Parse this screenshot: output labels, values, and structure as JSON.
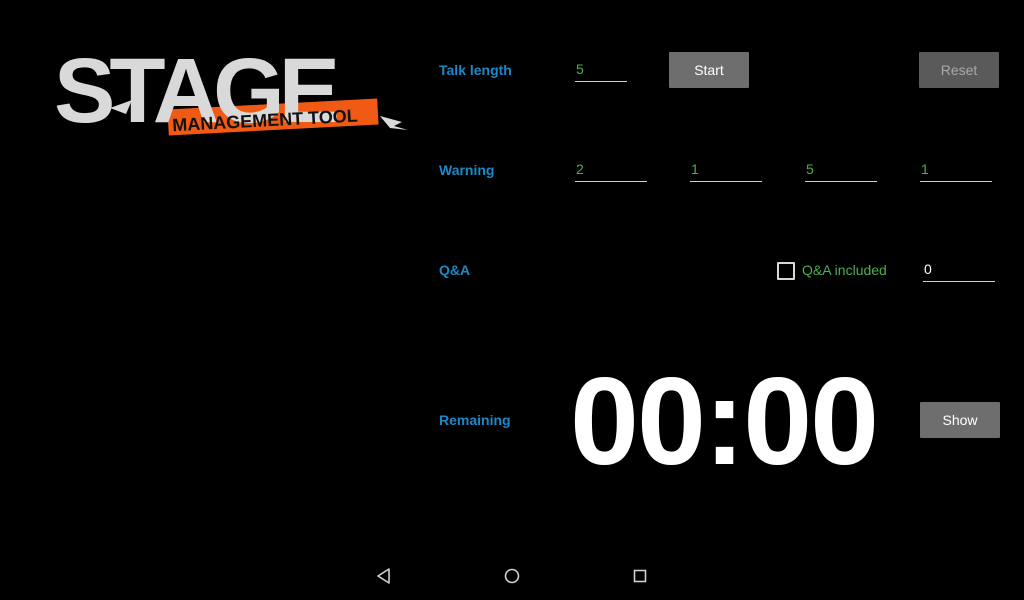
{
  "logo": {
    "main_text": "STAGE",
    "sub_text": "MANAGEMENT TOOL",
    "banner_color": "#f05a14",
    "text_color": "#d9d9d9"
  },
  "talk_length": {
    "label": "Talk length",
    "value": "5",
    "start_label": "Start",
    "reset_label": "Reset"
  },
  "warning": {
    "label": "Warning",
    "values": [
      "2",
      "1",
      "5",
      "1"
    ]
  },
  "qa": {
    "label": "Q&A",
    "checkbox_label": "Q&A included",
    "checked": false,
    "value": "0"
  },
  "remaining": {
    "label": "Remaining",
    "timer": "00:00",
    "show_label": "Show"
  },
  "navbar": {
    "back_icon": "back-triangle",
    "home_icon": "home-circle",
    "recents_icon": "recents-square"
  },
  "colors": {
    "label_blue": "#1e88c7",
    "value_green": "#4caf50",
    "button_gray": "#6e6e6e",
    "background": "#000000"
  }
}
